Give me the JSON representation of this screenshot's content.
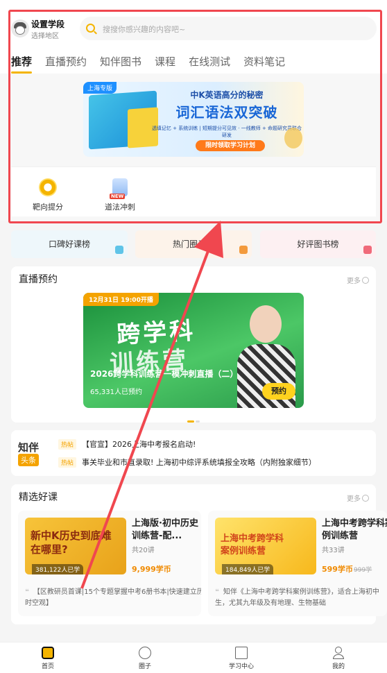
{
  "header": {
    "grade": "设置学段",
    "region": "选择地区",
    "search_placeholder": "搜搜你感兴趣的内容吧~"
  },
  "tabs": [
    "推荐",
    "直播预约",
    "知伴图书",
    "课程",
    "在线测试",
    "资料笔记"
  ],
  "banner": {
    "badge": "上海专版",
    "line1": "中K英语高分的秘密",
    "line2": "词汇语法双突破",
    "line3": "透填记忆 + 系统训练 | 短期提分可见效 · 一线教师 + 命题研究员联合研发",
    "cta": "限时领取学习计划"
  },
  "quick_links": [
    {
      "label": "靶向提分",
      "icon": "target-badge-icon"
    },
    {
      "label": "道法冲刺",
      "icon": "new-book-icon",
      "badge": "NEW"
    }
  ],
  "ranks": [
    {
      "label": "口碑好课榜",
      "color": "#eef7fb"
    },
    {
      "label": "热门圈子榜",
      "color": "#fdf3ea"
    },
    {
      "label": "好评图书榜",
      "color": "#fdf0f2"
    }
  ],
  "live": {
    "title": "直播预约",
    "more": "更多",
    "time": "12月31日 19:00开播",
    "big1": "跨学科",
    "big2": "训练营",
    "sub": "2026跨学科训练营一模冲刺直播（二）",
    "count": "65,331人已预约",
    "book": "预约"
  },
  "news": {
    "brand": "知伴",
    "tag": "头条",
    "hot": "热帖",
    "items": [
      "【官宣】2026上海中考报名启动!",
      "事关毕业和市直录取! 上海初中综评系统填报全攻略（内附独家细节）"
    ]
  },
  "courses": {
    "title": "精选好课",
    "more": "更多",
    "items": [
      {
        "title": "上海版·初中历史训练营-配...",
        "lessons": "共20讲",
        "price": "9,999学币",
        "old": "",
        "count": "381,122人已学",
        "thumb_text": "新中K历史到底难在哪里?",
        "desc": "【区教研员首课|15个专题掌握中考6册书本|快速建立历史时空观】"
      },
      {
        "title": "上海中考跨学科案例训练营",
        "lessons": "共33讲",
        "price": "599学币",
        "old": "999学",
        "count": "184,849人已学",
        "thumb_text": "上海中考跨学科案例训练营",
        "desc": "知伴《上海中考跨学科案例训练营》，适合上海初中生，尤其九年级及有地理、生物基础"
      }
    ]
  },
  "nav": [
    {
      "label": "首页",
      "icon": "home-icon"
    },
    {
      "label": "圈子",
      "icon": "planet-icon"
    },
    {
      "label": "学习中心",
      "icon": "book-open-icon"
    },
    {
      "label": "我的",
      "icon": "user-icon"
    }
  ],
  "colors": {
    "accent": "#f4b400",
    "annotation": "#f0474f"
  }
}
